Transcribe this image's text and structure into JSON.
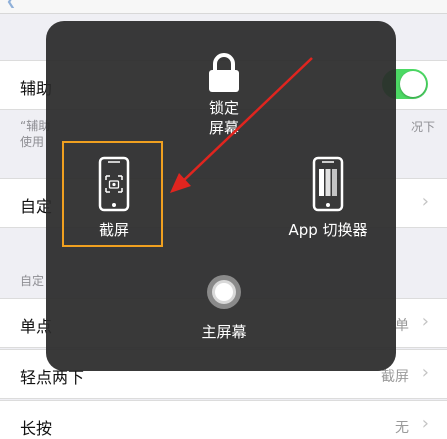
{
  "background": {
    "row_accessibility": {
      "label": "辅助"
    },
    "note": {
      "line1": "“辅助",
      "line2": "使用",
      "right": "况下"
    },
    "row_customize": {
      "label": "自定"
    },
    "section_custom_actions": {
      "header": "自定"
    },
    "row_single_tap": {
      "label": "单点",
      "value": "单"
    },
    "row_double_tap": {
      "label": "轻点两下",
      "value": "截屏"
    },
    "row_long_press": {
      "label": "长按",
      "value": "无"
    }
  },
  "menu": {
    "lock_screen": {
      "line1": "锁定",
      "line2": "屏幕",
      "icon": "lock-icon"
    },
    "screenshot": {
      "label": "截屏",
      "icon": "screenshot-phone-icon"
    },
    "app_switcher": {
      "label": "App 切换器",
      "icon": "app-switcher-icon"
    },
    "home": {
      "label": "主屏幕",
      "icon": "home-button-icon"
    }
  },
  "colors": {
    "toggle_on": "#4cd964",
    "highlight": "#f0a020",
    "arrow": "#e0251f",
    "overlay": "#2a2a2a"
  }
}
